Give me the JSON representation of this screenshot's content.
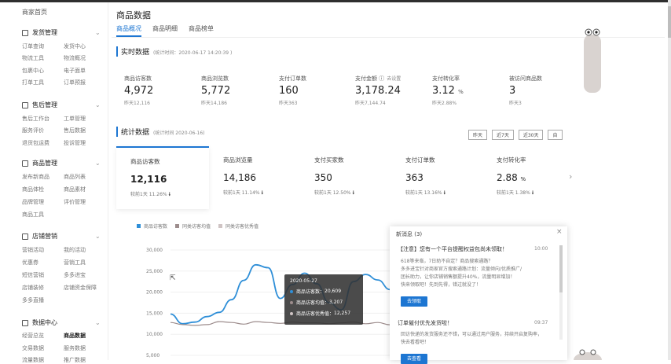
{
  "sidebar": {
    "home": "商家首页",
    "sections": [
      {
        "title": "发货管理",
        "items": [
          [
            "订单查询",
            "发货中心"
          ],
          [
            "物流工具",
            "物流概况"
          ],
          [
            "包裹中心",
            "电子面单"
          ],
          [
            "打单工具",
            "订单预报"
          ]
        ]
      },
      {
        "title": "售后管理",
        "items": [
          [
            "售后工作台",
            "工单管理"
          ],
          [
            "服务评价",
            "售后数据"
          ],
          [
            "退货包运费",
            "投诉管理"
          ]
        ]
      },
      {
        "title": "商品管理",
        "items": [
          [
            "发布新商品",
            "商品列表"
          ],
          [
            "商品体检",
            "商品素材"
          ],
          [
            "品牌管理",
            "评价管理"
          ],
          [
            "商品工具"
          ]
        ]
      },
      {
        "title": "店铺营销",
        "items": [
          [
            "营销活动",
            "我的活动"
          ],
          [
            "优惠券",
            "营销工具"
          ],
          [
            "短信营销",
            "多多进宝"
          ],
          [
            "店铺装修",
            "店铺资金保障"
          ],
          [
            "多多直播"
          ]
        ]
      },
      {
        "title": "数据中心",
        "items": [
          [
            "经营总览",
            "商品数据"
          ],
          [
            "交易数据",
            "服务数据"
          ],
          [
            "流量数据",
            "推广数据"
          ]
        ]
      }
    ],
    "active_item": "商品数据"
  },
  "header": {
    "title": "商品数据",
    "tabs": [
      "商品概况",
      "商品明细",
      "商品榜单"
    ],
    "active_tab": "商品概况"
  },
  "realtime": {
    "title": "实时数据",
    "stat_time": "(统计时间：2020-06-17 14:20:39 )",
    "metrics": [
      {
        "label": "商品访客数",
        "value": "4,972",
        "yesterday": "昨天12,116"
      },
      {
        "label": "商品浏览数",
        "value": "5,772",
        "yesterday": "昨天14,186"
      },
      {
        "label": "支付订单数",
        "value": "160",
        "yesterday": "昨天363"
      },
      {
        "label": "支付金额 ⓘ",
        "note": "去设置",
        "value": "3,178.24",
        "yesterday": "昨天7,144.74"
      },
      {
        "label": "支付转化率",
        "value": "3.12",
        "unit": "%",
        "yesterday": "昨天2.88%"
      },
      {
        "label": "被访问商品数",
        "value": "3",
        "yesterday": "昨天3"
      }
    ]
  },
  "stats": {
    "title": "统计数据",
    "stat_time": "(统计时间 2020-06-16)",
    "period_buttons": [
      "昨天",
      "近7天",
      "近30天",
      "自"
    ],
    "cards": [
      {
        "label": "商品访客数",
        "value": "12,116",
        "compare": "较前1天  11.26%"
      },
      {
        "label": "商品浏览量",
        "value": "14,186",
        "compare": "较前1天  11.14%"
      },
      {
        "label": "支付买家数",
        "value": "350",
        "compare": "较前1天  12.50%"
      },
      {
        "label": "支付订单数",
        "value": "363",
        "compare": "较前1天  13.16%"
      },
      {
        "label": "支付转化率",
        "value": "2.88",
        "unit": "%",
        "compare": "较前1天  1.38%"
      }
    ],
    "next_icon": "chevron-right-icon"
  },
  "chart_data": {
    "type": "line",
    "legend": [
      "商品访客数",
      "同类访客均值",
      "同类访客优秀值"
    ],
    "colors": {
      "main": "#2f8fd8",
      "avg": "#9d8d8d",
      "excellent": "#cfc4c4"
    },
    "yticks": [
      "30,000",
      "25,000",
      "20,000",
      "15,000",
      "10,000",
      "5,000"
    ],
    "ylim": [
      5000,
      30000
    ],
    "series": [
      {
        "name": "商品访客数",
        "values": [
          14800,
          12500,
          12900,
          14200,
          15200,
          18200,
          22800,
          26500,
          25800,
          18500,
          21800,
          24500,
          22000,
          17500,
          15800,
          22500,
          24200,
          22900,
          20609,
          18000,
          20300,
          24900,
          26600,
          23500,
          17200,
          15200
        ]
      },
      {
        "name": "商品访客均值",
        "values": [
          12800,
          12300,
          12100,
          12300,
          13000,
          12800,
          12400,
          13000,
          12800,
          12600,
          12900,
          12700,
          12700,
          12500,
          12700,
          12900,
          12500,
          12800,
          12257,
          12400,
          12600,
          12500,
          12700,
          12500,
          12400,
          12300
        ]
      }
    ],
    "tooltip": {
      "date": "2020-05-27",
      "rows": [
        {
          "label": "商品访客数：",
          "value": "20,609"
        },
        {
          "label": "商品访客均值：",
          "value": "3,207"
        },
        {
          "label": "商品访客优秀值：",
          "value": "12,257"
        }
      ]
    }
  },
  "notifications": {
    "title": "新消息 (3)",
    "items": [
      {
        "title": "【注意】您有一个平台提醒权益包尚未领取！",
        "time": "10:00",
        "body": [
          "618等来临，7日助不自定？商品搜索通路？",
          "多多进宝针对商家官方搜索通路计划：流量倾向/优质推广/",
          "团长助力，让你店铺销售额提升40%，流量明显增加！",
          "快来领取吧！先到先得，错过就没了！"
        ],
        "button": "去领取"
      },
      {
        "title": "订单催付优先发货啦！",
        "time": "09:37",
        "body": [
          "回访快递的发货服务还不错，可以通过用户服务，持续开启复购率，",
          "快去看看吧！"
        ],
        "button": "去查看"
      }
    ]
  }
}
